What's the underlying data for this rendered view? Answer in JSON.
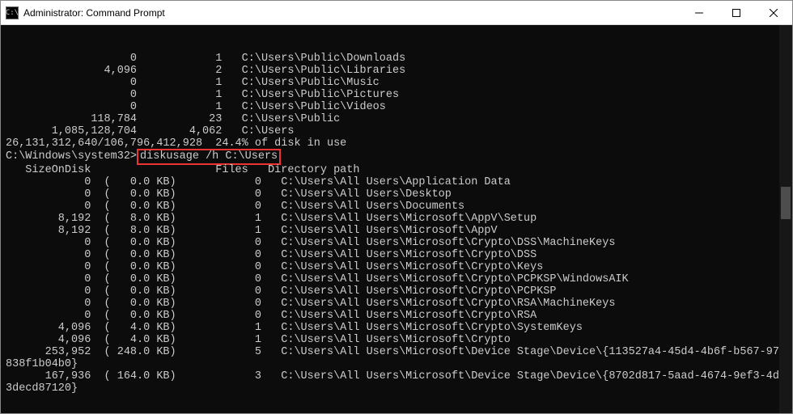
{
  "window": {
    "title": "Administrator: Command Prompt",
    "icon_label": "C:\\"
  },
  "top_rows": [
    {
      "size": "0",
      "files": "1",
      "path": "C:\\Users\\Public\\Downloads"
    },
    {
      "size": "4,096",
      "files": "2",
      "path": "C:\\Users\\Public\\Libraries"
    },
    {
      "size": "0",
      "files": "1",
      "path": "C:\\Users\\Public\\Music"
    },
    {
      "size": "0",
      "files": "1",
      "path": "C:\\Users\\Public\\Pictures"
    },
    {
      "size": "0",
      "files": "1",
      "path": "C:\\Users\\Public\\Videos"
    },
    {
      "size": "118,784",
      "files": "23",
      "path": "C:\\Users\\Public"
    },
    {
      "size": "1,085,128,704",
      "files": "4,062",
      "path": "C:\\Users"
    }
  ],
  "disk_summary": "26,131,312,640/106,796,412,928  24.4% of disk in use",
  "prompt_prefix": "C:\\Windows\\system32>",
  "prompt_command": "diskusage /h C:\\Users",
  "header_row": "   SizeOnDisk                   Files   Directory path",
  "bottom_rows": [
    {
      "size": "0",
      "human": "(   0.0 KB)",
      "files": "0",
      "path": "C:\\Users\\All Users\\Application Data"
    },
    {
      "size": "0",
      "human": "(   0.0 KB)",
      "files": "0",
      "path": "C:\\Users\\All Users\\Desktop"
    },
    {
      "size": "0",
      "human": "(   0.0 KB)",
      "files": "0",
      "path": "C:\\Users\\All Users\\Documents"
    },
    {
      "size": "8,192",
      "human": "(   8.0 KB)",
      "files": "1",
      "path": "C:\\Users\\All Users\\Microsoft\\AppV\\Setup"
    },
    {
      "size": "8,192",
      "human": "(   8.0 KB)",
      "files": "1",
      "path": "C:\\Users\\All Users\\Microsoft\\AppV"
    },
    {
      "size": "0",
      "human": "(   0.0 KB)",
      "files": "0",
      "path": "C:\\Users\\All Users\\Microsoft\\Crypto\\DSS\\MachineKeys"
    },
    {
      "size": "0",
      "human": "(   0.0 KB)",
      "files": "0",
      "path": "C:\\Users\\All Users\\Microsoft\\Crypto\\DSS"
    },
    {
      "size": "0",
      "human": "(   0.0 KB)",
      "files": "0",
      "path": "C:\\Users\\All Users\\Microsoft\\Crypto\\Keys"
    },
    {
      "size": "0",
      "human": "(   0.0 KB)",
      "files": "0",
      "path": "C:\\Users\\All Users\\Microsoft\\Crypto\\PCPKSP\\WindowsAIK"
    },
    {
      "size": "0",
      "human": "(   0.0 KB)",
      "files": "0",
      "path": "C:\\Users\\All Users\\Microsoft\\Crypto\\PCPKSP"
    },
    {
      "size": "0",
      "human": "(   0.0 KB)",
      "files": "0",
      "path": "C:\\Users\\All Users\\Microsoft\\Crypto\\RSA\\MachineKeys"
    },
    {
      "size": "0",
      "human": "(   0.0 KB)",
      "files": "0",
      "path": "C:\\Users\\All Users\\Microsoft\\Crypto\\RSA"
    },
    {
      "size": "4,096",
      "human": "(   4.0 KB)",
      "files": "1",
      "path": "C:\\Users\\All Users\\Microsoft\\Crypto\\SystemKeys"
    },
    {
      "size": "4,096",
      "human": "(   4.0 KB)",
      "files": "1",
      "path": "C:\\Users\\All Users\\Microsoft\\Crypto"
    },
    {
      "size": "253,952",
      "human": "( 248.0 KB)",
      "files": "5",
      "path": "C:\\Users\\All Users\\Microsoft\\Device Stage\\Device\\{113527a4-45d4-4b6f-b567-97838f1b04b0}",
      "wrap": true
    },
    {
      "size": "167,936",
      "human": "( 164.0 KB)",
      "files": "3",
      "path": "C:\\Users\\All Users\\Microsoft\\Device Stage\\Device\\{8702d817-5aad-4674-9ef3-4d3decd87120}",
      "wrap": true
    }
  ]
}
